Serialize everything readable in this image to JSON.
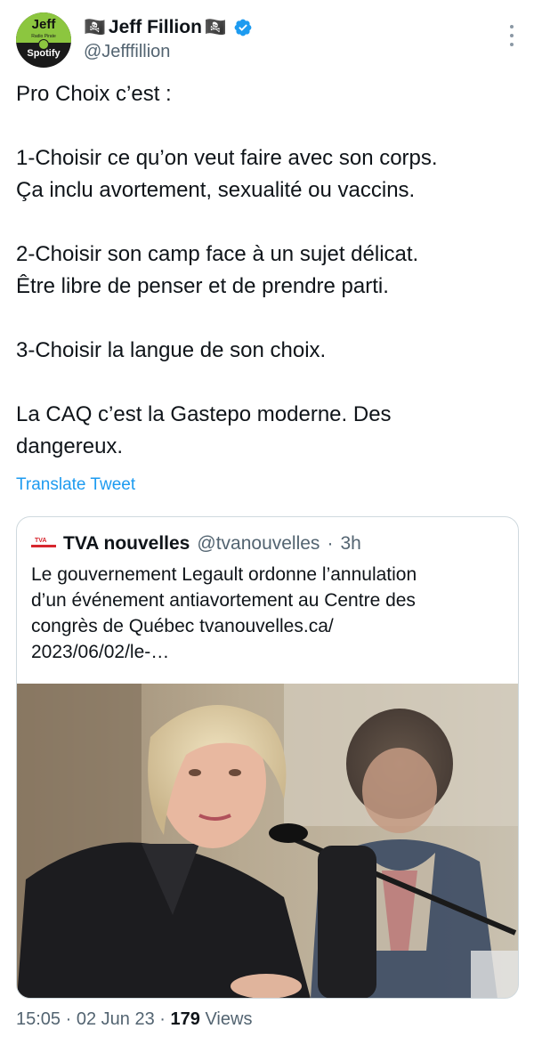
{
  "author": {
    "avatar_text_top": "Jeff",
    "avatar_text_small": "Radio Pirate",
    "avatar_text_bottom": "Spotify",
    "display_name": "Jeff Fillion",
    "name_decoration": "🏴‍☠️",
    "verified": true,
    "handle": "@Jefffillion"
  },
  "tweet": {
    "lines": [
      "Pro Choix c’est :",
      "",
      "1-Choisir ce qu’on veut faire avec son corps.",
      "Ça inclu avortement, sexualité ou vaccins.",
      "",
      "2-Choisir son camp face à un sujet délicat.",
      "Être libre de penser et de prendre parti.",
      "",
      "3-Choisir la langue de son choix.",
      "",
      "La CAQ c’est la Gastepo moderne. Des",
      "dangereux."
    ],
    "translate_label": "Translate Tweet"
  },
  "quoted": {
    "logo_text": "TVA NOUVELLES",
    "name": "TVA nouvelles",
    "handle": "@tvanouvelles",
    "separator": "·",
    "time": "3h",
    "lines": [
      "Le gouvernement Legault ordonne l’annulation",
      "d’un événement antiavortement au Centre des",
      "congrès de Québec tvanouvelles.ca/",
      "2023/06/02/le-…"
    ]
  },
  "footer": {
    "time": "15:05",
    "sep1": "·",
    "date": "02 Jun 23",
    "sep2": "·",
    "views_count": "179",
    "views_label": "Views"
  },
  "colors": {
    "link": "#1d9bf0",
    "secondary_text": "#536471",
    "verified": "#1d9bf0",
    "border": "#cfd9de"
  },
  "icons": {
    "verified": "verified-badge-icon",
    "more": "more-options-icon"
  }
}
